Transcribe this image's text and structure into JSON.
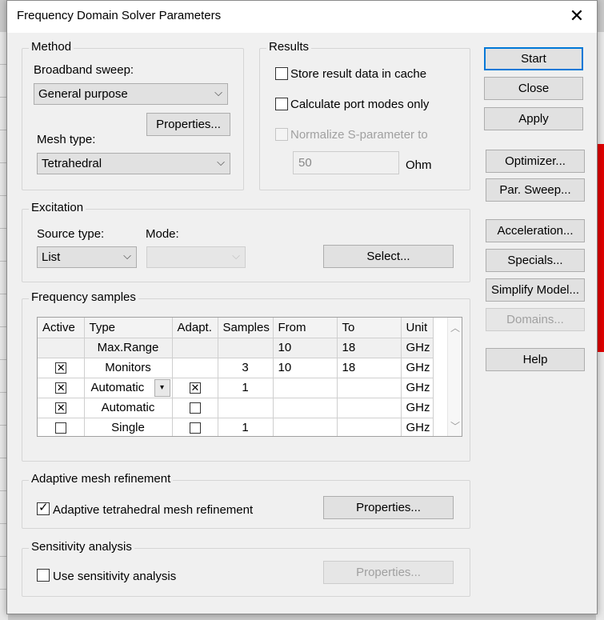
{
  "dialog": {
    "title": "Frequency Domain Solver Parameters",
    "close_symbol": "✕"
  },
  "method": {
    "legend": "Method",
    "broadband_label": "Broadband sweep:",
    "broadband_value": "General purpose",
    "properties_label": "Properties...",
    "mesh_type_label": "Mesh type:",
    "mesh_type_value": "Tetrahedral"
  },
  "results": {
    "legend": "Results",
    "store_cache_label": "Store result data in cache",
    "store_cache_checked": false,
    "port_modes_label": "Calculate port modes only",
    "port_modes_checked": false,
    "normalize_label": "Normalize S-parameter to",
    "normalize_checked": false,
    "normalize_value": "50",
    "ohm_label": "Ohm"
  },
  "excitation": {
    "legend": "Excitation",
    "source_type_label": "Source type:",
    "source_type_value": "List",
    "mode_label": "Mode:",
    "mode_value": "",
    "select_label": "Select..."
  },
  "frequency_samples": {
    "legend": "Frequency samples",
    "columns": [
      "Active",
      "Type",
      "Adapt.",
      "Samples",
      "From",
      "To",
      "Unit"
    ],
    "rows": [
      {
        "active": "",
        "type": "Max.Range",
        "adapt": "",
        "samples": "",
        "from": "10",
        "to": "18",
        "unit": "GHz"
      },
      {
        "active": "checked",
        "type": "Monitors",
        "adapt": "",
        "samples": "3",
        "from": "10",
        "to": "18",
        "unit": "GHz"
      },
      {
        "active": "checked",
        "type": "Automatic",
        "adapt": "checked",
        "samples": "1",
        "from": "",
        "to": "",
        "unit": "GHz"
      },
      {
        "active": "checked",
        "type": "Automatic",
        "adapt": "unchecked",
        "samples": "",
        "from": "",
        "to": "",
        "unit": "GHz"
      },
      {
        "active": "unchecked",
        "type": "Single",
        "adapt": "unchecked",
        "samples": "1",
        "from": "",
        "to": "",
        "unit": "GHz"
      }
    ]
  },
  "adaptive_mesh": {
    "legend": "Adaptive mesh refinement",
    "checkbox_label": "Adaptive tetrahedral mesh refinement",
    "checked": true,
    "properties_label": "Properties..."
  },
  "sensitivity": {
    "legend": "Sensitivity analysis",
    "checkbox_label": "Use sensitivity analysis",
    "checked": false,
    "properties_label": "Properties..."
  },
  "side_buttons": {
    "start": "Start",
    "close": "Close",
    "apply": "Apply",
    "optimizer": "Optimizer...",
    "par_sweep": "Par. Sweep...",
    "acceleration": "Acceleration...",
    "specials": "Specials...",
    "simplify_model": "Simplify Model...",
    "domains": "Domains...",
    "help": "Help"
  },
  "symbols": {
    "check": "✓",
    "cross_check": "✕",
    "dropdown_arrow": "⌵",
    "small_down": "▾",
    "scroll_up": "︿",
    "scroll_down": "﹀"
  },
  "colors": {
    "accent_border": "#0078d7",
    "dialog_bg": "#f0f0f0",
    "background_red": "#e00000"
  }
}
